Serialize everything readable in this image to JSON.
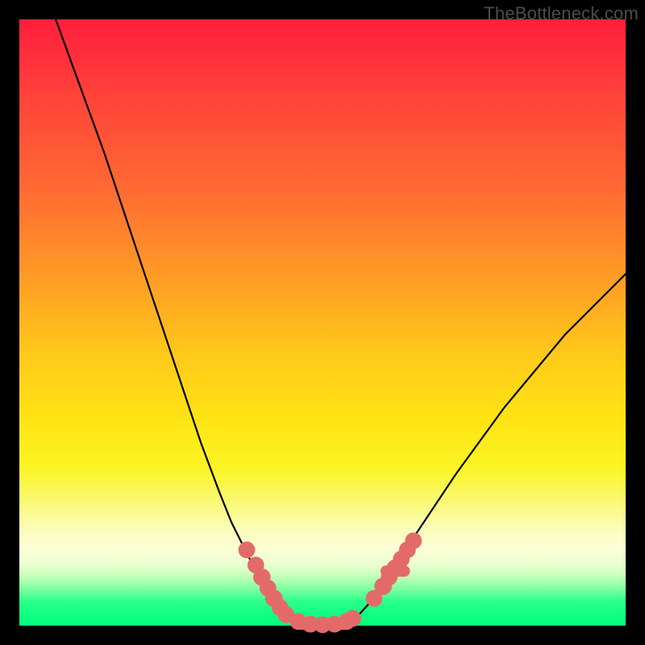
{
  "watermark": "TheBottleneck.com",
  "chart_data": {
    "type": "line",
    "title": "",
    "xlabel": "",
    "ylabel": "",
    "xlim": [
      0,
      100
    ],
    "ylim": [
      0,
      100
    ],
    "series": [
      {
        "name": "bottleneck-curve",
        "x": [
          6,
          10,
          14,
          18,
          22,
          26,
          30,
          33,
          35,
          37,
          39,
          41,
          42,
          43,
          44,
          46,
          48,
          50,
          52,
          54,
          56,
          58,
          62,
          66,
          72,
          80,
          90,
          100
        ],
        "y": [
          100,
          89,
          78,
          66,
          54,
          42,
          30,
          22,
          17,
          13,
          9,
          6,
          4,
          2.5,
          1.5,
          0.6,
          0.2,
          0.1,
          0.2,
          0.6,
          1.8,
          4,
          10,
          16,
          25,
          36,
          48,
          58
        ]
      }
    ],
    "markers": [
      {
        "x": 37.5,
        "y": 12.5,
        "r": 1.3
      },
      {
        "x": 39.0,
        "y": 10.0,
        "r": 1.3
      },
      {
        "x": 40.0,
        "y": 8.0,
        "r": 1.4
      },
      {
        "x": 41.0,
        "y": 6.2,
        "r": 1.3
      },
      {
        "x": 42.0,
        "y": 4.5,
        "r": 1.4
      },
      {
        "x": 43.0,
        "y": 3.0,
        "r": 1.3
      },
      {
        "x": 44.0,
        "y": 1.8,
        "r": 1.3
      },
      {
        "x": 46.0,
        "y": 0.7,
        "r": 1.3
      },
      {
        "x": 48.0,
        "y": 0.25,
        "r": 1.3
      },
      {
        "x": 50.0,
        "y": 0.15,
        "r": 1.3
      },
      {
        "x": 52.0,
        "y": 0.25,
        "r": 1.3
      },
      {
        "x": 54.0,
        "y": 0.7,
        "r": 1.3
      },
      {
        "x": 55.0,
        "y": 1.2,
        "r": 1.3
      },
      {
        "x": 58.5,
        "y": 4.5,
        "r": 1.3
      },
      {
        "x": 60.0,
        "y": 6.5,
        "r": 1.4
      },
      {
        "x": 61.0,
        "y": 8.0,
        "r": 1.3
      },
      {
        "x": 62.0,
        "y": 9.5,
        "r": 1.4
      },
      {
        "x": 63.0,
        "y": 11.0,
        "r": 1.3
      },
      {
        "x": 64.0,
        "y": 12.5,
        "r": 1.3
      },
      {
        "x": 65.0,
        "y": 14.0,
        "r": 1.3
      }
    ],
    "marker_bars": [
      {
        "x1": 46.0,
        "x2": 54.0,
        "y": 0.25
      },
      {
        "x1": 60.5,
        "x2": 63.5,
        "y": 9.0
      }
    ],
    "colors": {
      "curve": "#000000",
      "marker": "#e46a6a",
      "background_top": "#ff1e3c",
      "background_bottom": "#03ff7e"
    }
  }
}
